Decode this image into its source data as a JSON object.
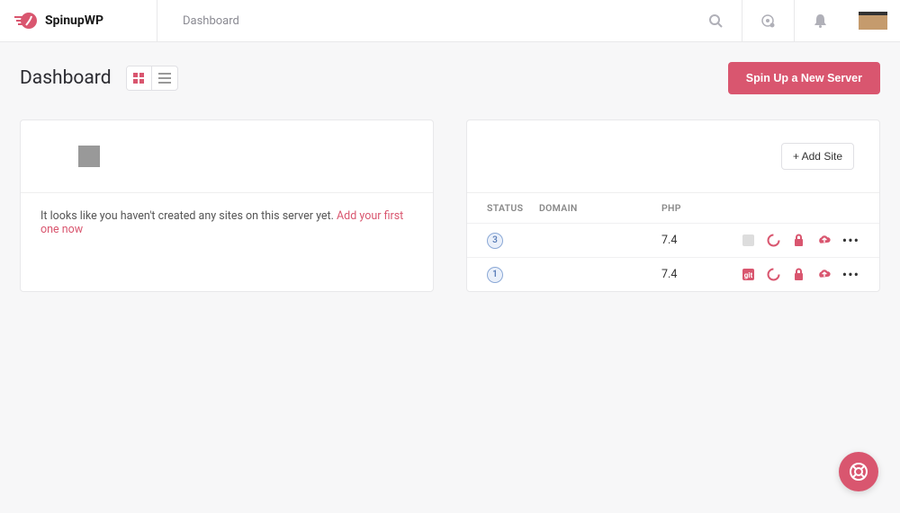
{
  "brand": {
    "name": "SpinupWP"
  },
  "breadcrumb": "Dashboard",
  "page": {
    "title": "Dashboard"
  },
  "buttons": {
    "spin_up": "Spin Up a New Server",
    "add_site": "+ Add Site"
  },
  "empty_server": {
    "message": "It looks like you haven't created any sites on this server yet. ",
    "link": "Add your first one now"
  },
  "table": {
    "headers": {
      "status": "STATUS",
      "domain": "DOMAIN",
      "php": "PHP"
    },
    "rows": [
      {
        "status": "3",
        "domain": "",
        "php": "7.4",
        "git_muted": true
      },
      {
        "status": "1",
        "domain": "",
        "php": "7.4",
        "git_muted": false
      }
    ]
  }
}
